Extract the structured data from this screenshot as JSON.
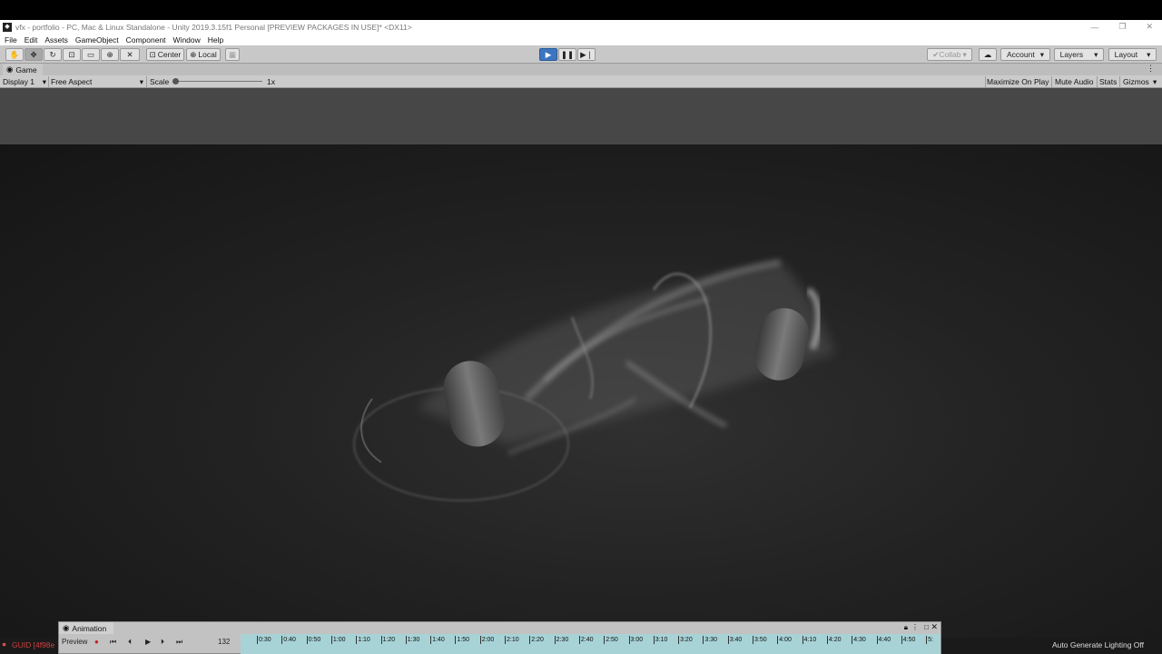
{
  "window": {
    "title": "vfx - portfolio - PC, Mac & Linux Standalone - Unity 2019.3.15f1 Personal [PREVIEW PACKAGES IN USE]* <DX11>",
    "controls": [
      "—",
      "❐",
      "✕"
    ]
  },
  "menu": [
    "File",
    "Edit",
    "Assets",
    "GameObject",
    "Component",
    "Window",
    "Help"
  ],
  "toolbar": {
    "tools": [
      "hand-tool",
      "move-tool",
      "rotate-tool",
      "scale-tool",
      "rect-tool",
      "transform-tool",
      "custom-tool"
    ],
    "pivot": "Center",
    "space": "Local",
    "collab": "Collab",
    "account": "Account",
    "layers": "Layers",
    "layout": "Layout",
    "playing": true
  },
  "game_tab": {
    "label": "Game"
  },
  "game_bar": {
    "display": "Display 1",
    "aspect": "Free Aspect",
    "scale_label": "Scale",
    "scale_value": "1x",
    "maximize": "Maximize On Play",
    "mute": "Mute Audio",
    "stats": "Stats",
    "gizmos": "Gizmos"
  },
  "status": {
    "error": "GUID [4f98e",
    "lighting": "Auto Generate Lighting Off"
  },
  "animation": {
    "tab": "Animation",
    "preview": "Preview",
    "frame": "132",
    "ticks": [
      "0:30",
      "0:40",
      "0:50",
      "1:00",
      "1:10",
      "1:20",
      "1:30",
      "1:40",
      "1:50",
      "2:00",
      "2:10",
      "2:20",
      "2:30",
      "2:40",
      "2:50",
      "3:00",
      "3:10",
      "3:20",
      "3:30",
      "3:40",
      "3:50",
      "4:00",
      "4:10",
      "4:20",
      "4:30",
      "4:40",
      "4:50",
      "5:"
    ]
  },
  "colors": {
    "accent": "#3c76c0",
    "timeline": "#a7d3d7"
  }
}
